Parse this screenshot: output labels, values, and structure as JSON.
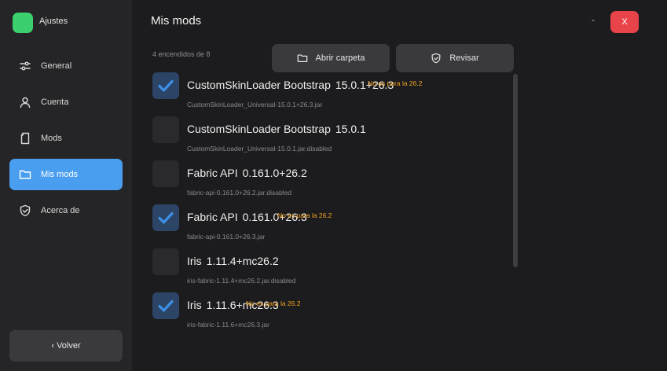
{
  "app": {
    "name": "Ajustes",
    "logo_color": "#3ccf6e"
  },
  "sidebar": {
    "items": [
      {
        "label": "General",
        "icon": "sliders-icon"
      },
      {
        "label": "Cuenta",
        "icon": "user-icon"
      },
      {
        "label": "Mods",
        "icon": "file-icon"
      },
      {
        "label": "Mis mods",
        "icon": "folder-icon",
        "active": true
      },
      {
        "label": "Acerca de",
        "icon": "shield-check-icon"
      }
    ],
    "back_label": "‹ Volver"
  },
  "header": {
    "title": "Mis mods",
    "minimize_label": "-",
    "close_label": "X"
  },
  "toolbar": {
    "count_label": "4 encendidos de 8",
    "open_folder_label": "Abrir carpeta",
    "review_label": "Revisar"
  },
  "mods": [
    {
      "name": "CustomSkinLoader Bootstrap",
      "version": "15.0.1+26.3",
      "file": "CustomSkinLoader_Universal-15.0.1+26.3.jar",
      "enabled": true,
      "warning": "No es para la 26.2"
    },
    {
      "name": "CustomSkinLoader Bootstrap",
      "version": "15.0.1",
      "file": "CustomSkinLoader_Universal-15.0.1.jar.disabled",
      "enabled": false,
      "warning": ""
    },
    {
      "name": "Fabric API",
      "version": "0.161.0+26.2",
      "file": "fabric-api-0.161.0+26.2.jar.disabled",
      "enabled": false,
      "warning": ""
    },
    {
      "name": "Fabric API",
      "version": "0.161.0+26.3",
      "file": "fabric-api-0.161.0+26.3.jar",
      "enabled": true,
      "warning": "No es para la 26.2"
    },
    {
      "name": "Iris",
      "version": "1.11.4+mc26.2",
      "file": "iris-fabric-1.11.4+mc26.2.jar.disabled",
      "enabled": false,
      "warning": ""
    },
    {
      "name": "Iris",
      "version": "1.11.6+mc26.3",
      "file": "iris-fabric-1.11.6+mc26.3.jar",
      "enabled": true,
      "warning": "No es para la 26.2"
    }
  ],
  "colors": {
    "accent": "#4a9ef0",
    "warning": "#f5a623",
    "close": "#e9434a"
  }
}
